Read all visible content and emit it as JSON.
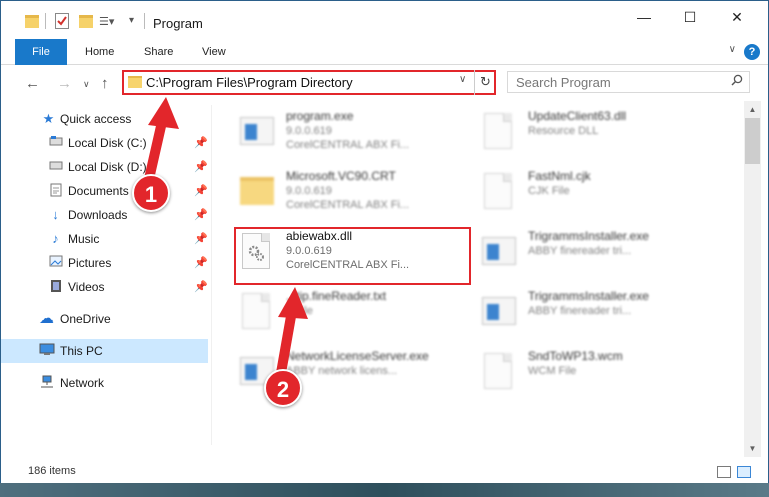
{
  "window": {
    "title": "Program",
    "controls": {
      "minimize": "—",
      "maximize": "☐",
      "close": "✕"
    }
  },
  "ribbon": {
    "tabs": [
      "File",
      "Home",
      "Share",
      "View"
    ],
    "help": "?"
  },
  "address": {
    "path": "C:\\Program Files\\Program Directory",
    "dropdown": "∨",
    "refresh": "↻"
  },
  "search": {
    "placeholder": "Search Program"
  },
  "sidebar": {
    "items": [
      {
        "label": "Quick access",
        "icon": "star-icon"
      },
      {
        "label": "Local Disk (C:)",
        "icon": "drive-icon",
        "pinned": true
      },
      {
        "label": "Local Disk (D:)",
        "icon": "drive-icon",
        "pinned": true
      },
      {
        "label": "Documents",
        "icon": "documents-icon",
        "pinned": true
      },
      {
        "label": "Downloads",
        "icon": "downloads-icon",
        "pinned": true
      },
      {
        "label": "Music",
        "icon": "music-icon",
        "pinned": true
      },
      {
        "label": "Pictures",
        "icon": "pictures-icon",
        "pinned": true
      },
      {
        "label": "Videos",
        "icon": "videos-icon",
        "pinned": true
      },
      {
        "label": "OneDrive",
        "icon": "cloud-icon"
      },
      {
        "label": "This PC",
        "icon": "computer-icon",
        "selected": true
      },
      {
        "label": "Network",
        "icon": "network-icon"
      }
    ]
  },
  "files": [
    {
      "name": "program.exe",
      "line2": "9.0.0.619",
      "line3": "CorelCENTRAL ABX Fi..."
    },
    {
      "name": "UpdateClient63.dll",
      "line2": "Resource DLL",
      "line3": ""
    },
    {
      "name": "Microsoft.VC90.CRT",
      "line2": "9.0.0.619",
      "line3": "CorelCENTRAL ABX Fi..."
    },
    {
      "name": "FastNml.cjk",
      "line2": "CJK File",
      "line3": ""
    },
    {
      "name": "abiewabx.dll",
      "line2": "9.0.0.619",
      "line3": "CorelCENTRAL ABX Fi..."
    },
    {
      "name": "TrigrammsInstaller.exe",
      "line2": "ABBY finereader tri...",
      "line3": ""
    },
    {
      "name": "...tip.fineReader.txt",
      "line2": "...File",
      "line3": ""
    },
    {
      "name": "TrigrammsInstaller.exe",
      "line2": "ABBY finereader tri...",
      "line3": ""
    },
    {
      "name": "NetworkLicenseServer.exe",
      "line2": "ABBY network licens...",
      "line3": ""
    },
    {
      "name": "SndToWP13.wcm",
      "line2": "WCM File",
      "line3": ""
    }
  ],
  "status": {
    "count": "186 items"
  },
  "annotations": {
    "step1": "1",
    "step2": "2"
  },
  "colors": {
    "accent": "#1979ca",
    "highlight": "#e2262b",
    "selected": "#cce8ff"
  }
}
